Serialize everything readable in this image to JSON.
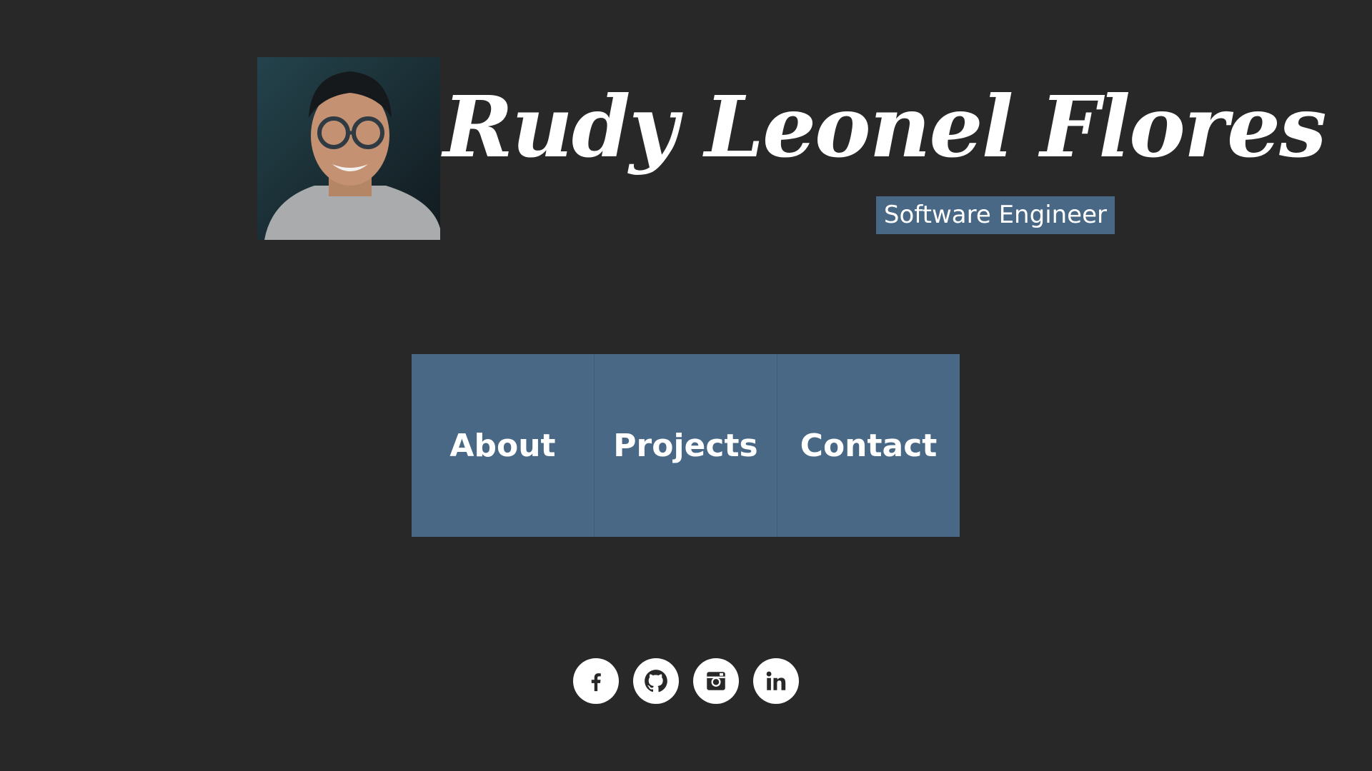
{
  "header": {
    "name": "Rudy Leonel Flores",
    "role": "Software Engineer"
  },
  "nav": {
    "items": [
      {
        "label": "About"
      },
      {
        "label": "Projects"
      },
      {
        "label": "Contact"
      }
    ]
  },
  "social": {
    "icons": [
      "facebook-icon",
      "github-icon",
      "instagram-icon",
      "linkedin-icon"
    ]
  },
  "colors": {
    "background": "#282828",
    "accent": "#486885",
    "text": "#ffffff"
  }
}
